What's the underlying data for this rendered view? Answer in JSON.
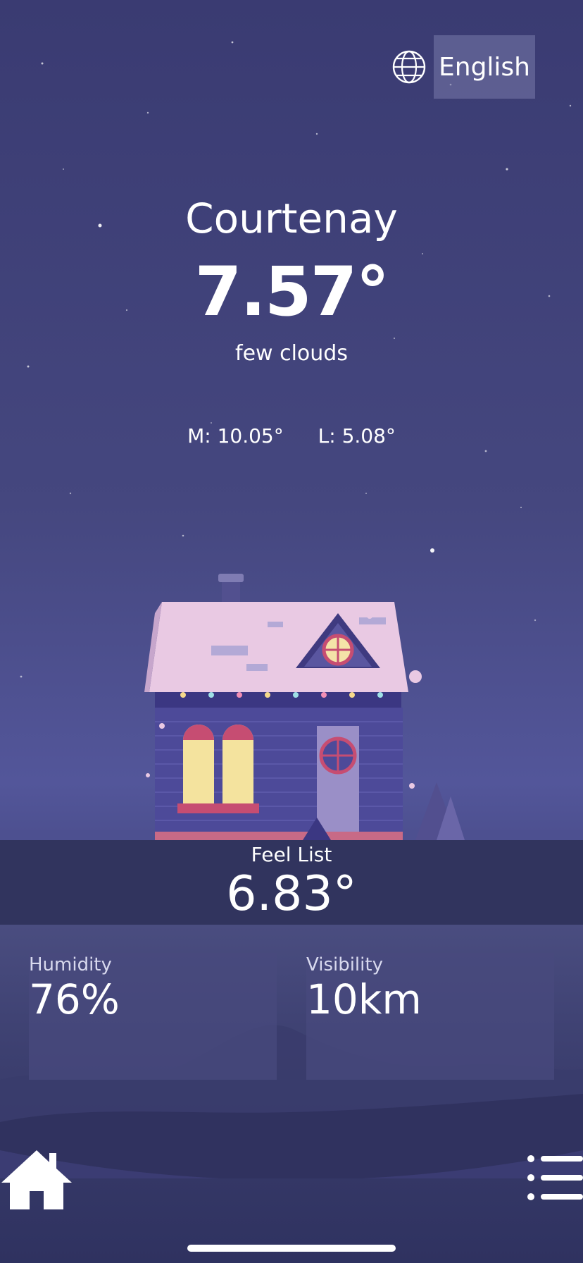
{
  "language": {
    "label": "English",
    "icon": "globe-icon"
  },
  "weather": {
    "city": "Courtenay",
    "temperature": "7.57°",
    "description": "few clouds",
    "max": "M: 10.05°",
    "min": "L: 5.08°"
  },
  "feel": {
    "label": "Feel List",
    "value": "6.83°"
  },
  "cards": {
    "humidity": {
      "label": "Humidity",
      "value": "76%"
    },
    "visibility": {
      "label": "Visibility",
      "value": "10km"
    }
  },
  "nav": {
    "home_icon": "home-icon",
    "menu_icon": "menu-list-icon"
  },
  "colors": {
    "sky_top": "#3a3b72",
    "panel": "#31345e",
    "card": "#484a7d"
  }
}
